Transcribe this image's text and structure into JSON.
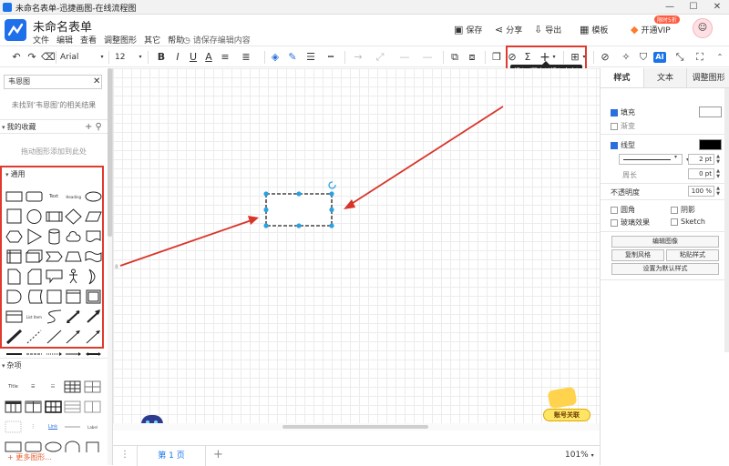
{
  "window": {
    "title": "未命名表单-迅捷画图-在线流程图",
    "controls": [
      "—",
      "☐",
      "✕"
    ]
  },
  "header": {
    "doc_title": "未命名表单",
    "menu": [
      "文件",
      "编辑",
      "查看",
      "调整图形",
      "其它",
      "帮助"
    ],
    "save_hint": "请保存编辑内容",
    "actions": {
      "save": "保存",
      "share": "分享",
      "export": "导出",
      "template": "模板",
      "vip": "开通VIP"
    },
    "vip_badge": "限时5折"
  },
  "toolbar": {
    "font_name": "Arial",
    "font_size": "12",
    "bold": "B",
    "italic": "I",
    "underline": "U",
    "font_color": "A",
    "sum": "Σ",
    "insert": "+",
    "ai": "AI",
    "tooltip": "插入 (双击以插入文字)"
  },
  "left_panel": {
    "search_value": "韦恩图",
    "search_empty": "未找到'韦恩图'的相关结果",
    "favorites_title": "我的收藏",
    "favorites_hint": "拖动图形添加到此处",
    "general_title": "通用",
    "text_label": "Text",
    "heading_label": "Heading",
    "list_label": "List Item",
    "misc_title": "杂项",
    "misc_title_label": "Title",
    "misc_link_label": "Link",
    "misc_label": "Label",
    "more_shapes": "+ 更多图形..."
  },
  "status": {
    "page_tab": "第 1 页",
    "zoom": "101%",
    "add_page": "+",
    "page_menu": "⋮"
  },
  "right_panel": {
    "tabs": [
      "样式",
      "文本",
      "调整图形"
    ],
    "fill": "填充",
    "gradient": "渐变",
    "line": "线型",
    "line_width": "2 pt",
    "perimeter": "周长",
    "perimeter_value": "0 pt",
    "opacity": "不透明度",
    "opacity_value": "100 %",
    "rounded": "圆角",
    "shadow": "阴影",
    "glass": "玻璃效果",
    "sketch": "Sketch",
    "edit_image": "编辑图像",
    "copy_style": "复制风格",
    "paste_style": "粘贴样式",
    "set_default": "设置为默认样式"
  },
  "promo": {
    "label": "账号关联"
  },
  "colors": {
    "accent": "#1a73e8",
    "highlight": "#e03a2f",
    "selection": "#29a3e0",
    "arrow": "#d8352a"
  }
}
